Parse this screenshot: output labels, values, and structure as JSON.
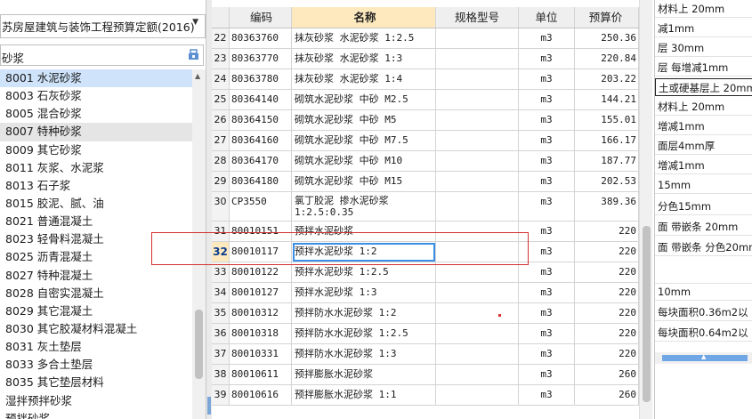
{
  "left": {
    "quota_select": "苏房屋建筑与装饰工程预算定额(2016)",
    "search_value": "砂浆",
    "categories": [
      "8001 水泥砂浆",
      "8003 石灰砂浆",
      "8005 混合砂浆",
      "8007 特种砂浆",
      "8009 其它砂浆",
      "8011 灰浆、水泥浆",
      "8013 石子浆",
      "8015 胶泥、腻、油",
      "8021 普通混凝土",
      "8023 轻骨料混凝土",
      "8025 沥青混凝土",
      "8027 特种混凝土",
      "8028 自密实混凝土",
      "8029 其它混凝土",
      "8030 其它胶凝材料混凝土",
      "8031 灰土垫层",
      "8033 多合土垫层",
      "8035 其它垫层材料",
      "湿拌预拌砂浆",
      "预拌砂浆"
    ]
  },
  "grid": {
    "headers": {
      "code": "编码",
      "name": "名称",
      "spec": "规格型号",
      "unit": "单位",
      "price": "预算价"
    },
    "rows": [
      {
        "idx": "22",
        "code": "80363760",
        "name": "抹灰砂浆 水泥砂浆 1:2.5",
        "unit": "m3",
        "price": "250.36"
      },
      {
        "idx": "23",
        "code": "80363770",
        "name": "抹灰砂浆 水泥砂浆 1:3",
        "unit": "m3",
        "price": "220.84"
      },
      {
        "idx": "24",
        "code": "80363780",
        "name": "抹灰砂浆 水泥砂浆 1:4",
        "unit": "m3",
        "price": "203.22"
      },
      {
        "idx": "25",
        "code": "80364140",
        "name": "砌筑水泥砂浆 中砂 M2.5",
        "unit": "m3",
        "price": "144.21"
      },
      {
        "idx": "26",
        "code": "80364150",
        "name": "砌筑水泥砂浆 中砂 M5",
        "unit": "m3",
        "price": "155.01"
      },
      {
        "idx": "27",
        "code": "80364160",
        "name": "砌筑水泥砂浆 中砂 M7.5",
        "unit": "m3",
        "price": "166.17"
      },
      {
        "idx": "28",
        "code": "80364170",
        "name": "砌筑水泥砂浆 中砂 M10",
        "unit": "m3",
        "price": "187.77"
      },
      {
        "idx": "29",
        "code": "80364180",
        "name": "砌筑水泥砂浆 中砂 M15",
        "unit": "m3",
        "price": "202.53"
      },
      {
        "idx": "30",
        "code": "CP3550",
        "name": "氯丁胶泥 掺水泥砂浆 1:2.5:0.35",
        "unit": "m3",
        "price": "389.36"
      },
      {
        "idx": "31",
        "code": "80010151",
        "name": "预拌水泥砂浆",
        "unit": "m3",
        "price": "220"
      },
      {
        "idx": "32",
        "code": "80010117",
        "name": "预拌水泥砂浆 1:2",
        "unit": "m3",
        "price": "220"
      },
      {
        "idx": "33",
        "code": "80010122",
        "name": "预拌水泥砂浆 1:2.5",
        "unit": "m3",
        "price": "220"
      },
      {
        "idx": "34",
        "code": "80010127",
        "name": "预拌水泥砂浆 1:3",
        "unit": "m3",
        "price": "220"
      },
      {
        "idx": "35",
        "code": "80010312",
        "name": "预拌防水水泥砂浆 1:2",
        "unit": "m3",
        "price": "220"
      },
      {
        "idx": "36",
        "code": "80010318",
        "name": "预拌防水水泥砂浆 1:2.5",
        "unit": "m3",
        "price": "220"
      },
      {
        "idx": "37",
        "code": "80010331",
        "name": "预拌防水水泥砂浆 1:3",
        "unit": "m3",
        "price": "220"
      },
      {
        "idx": "38",
        "code": "80010611",
        "name": "预拌膨胀水泥砂浆",
        "unit": "m3",
        "price": "260"
      },
      {
        "idx": "39",
        "code": "80010616",
        "name": "预拌膨胀水泥砂浆 1:1",
        "unit": "m3",
        "price": "260"
      }
    ]
  },
  "right": {
    "items": [
      "材料上 20mm",
      "减1mm",
      "层 30mm",
      "层 每增减1mm",
      "土或硬基层上 20mm",
      "材料上 20mm",
      "增减1mm",
      "面层4mm厚",
      "增减1mm",
      "15mm",
      "分色15mm",
      "面 带嵌条 20mm",
      "面 带嵌条 分色20mm",
      "",
      "10mm",
      "每块面积0.36m2以",
      "每块面积0.64m2以"
    ]
  }
}
